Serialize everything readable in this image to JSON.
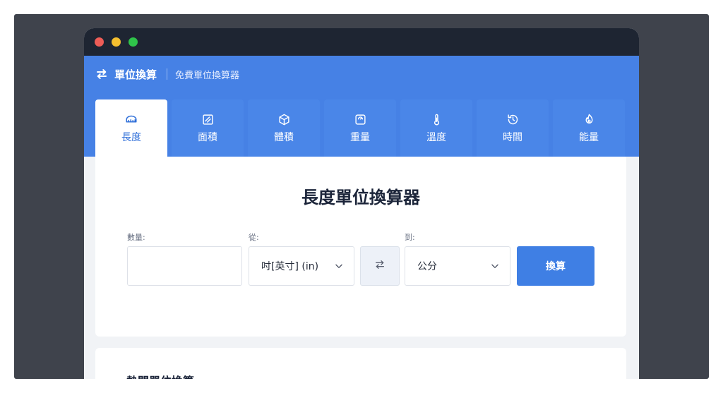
{
  "brand": {
    "name": "單位換算",
    "subtitle": "免費單位換算器"
  },
  "tabs": [
    {
      "label": "長度",
      "icon": "ruler-icon",
      "active": true
    },
    {
      "label": "面積",
      "icon": "area-icon",
      "active": false
    },
    {
      "label": "體積",
      "icon": "cube-icon",
      "active": false
    },
    {
      "label": "重量",
      "icon": "scale-icon",
      "active": false
    },
    {
      "label": "溫度",
      "icon": "thermometer-icon",
      "active": false
    },
    {
      "label": "時間",
      "icon": "clock-icon",
      "active": false
    },
    {
      "label": "能量",
      "icon": "fire-icon",
      "active": false
    }
  ],
  "converter": {
    "title": "長度單位換算器",
    "amount_label": "數量:",
    "amount_value": "",
    "from_label": "從:",
    "from_value": "吋[英寸] (in)",
    "to_label": "到:",
    "to_value": "公分",
    "convert_label": "換算"
  },
  "popular": {
    "title": "熱門單位換算"
  },
  "colors": {
    "accent": "#4681e5",
    "titlebar": "#1e2532",
    "heading": "#1b2439"
  }
}
